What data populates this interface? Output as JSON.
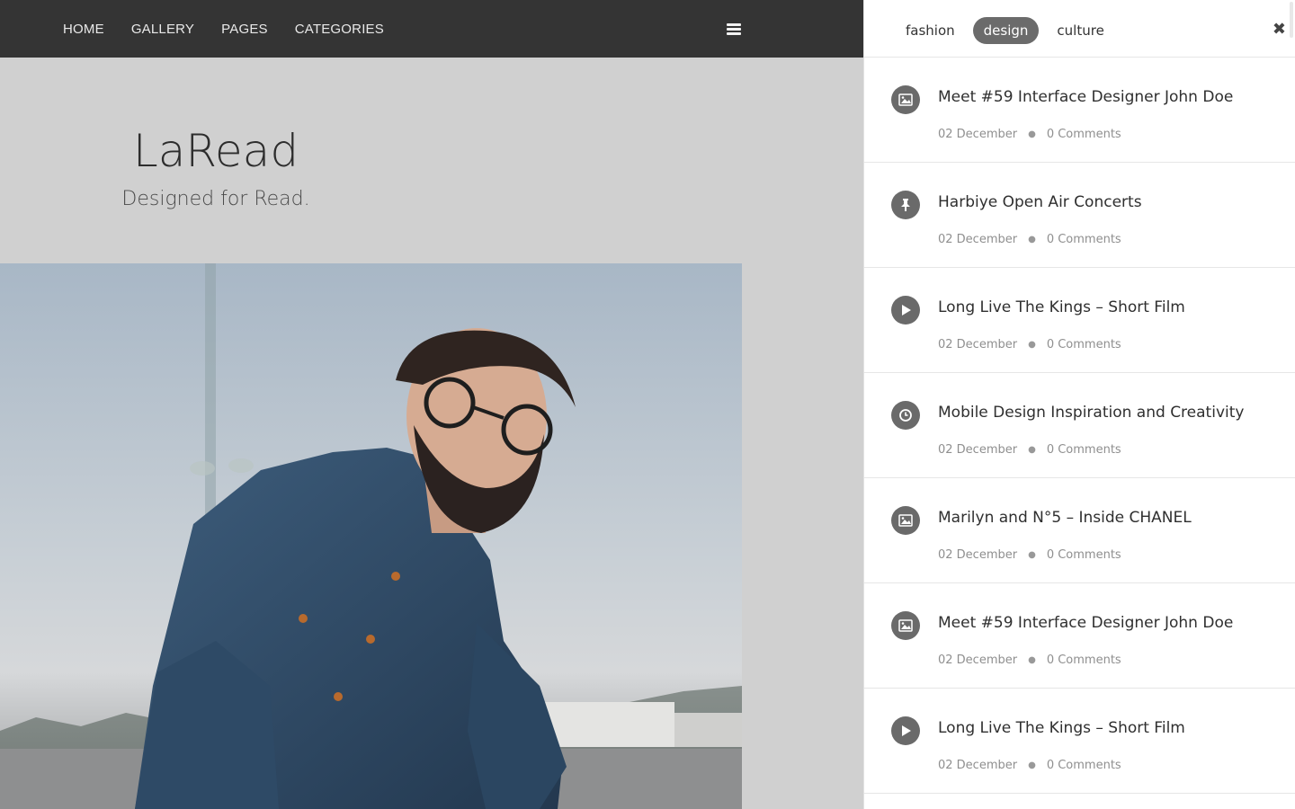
{
  "nav": {
    "items": [
      "HOME",
      "GALLERY",
      "PAGES",
      "CATEGORIES"
    ]
  },
  "hero": {
    "title": "LaRead",
    "tagline": "Designed for Read."
  },
  "drawer": {
    "tabs": [
      {
        "label": "fashion",
        "active": false
      },
      {
        "label": "design",
        "active": true
      },
      {
        "label": "culture",
        "active": false
      }
    ],
    "close_icon": "close-icon",
    "posts": [
      {
        "icon": "image-icon",
        "title": "Meet #59 Interface Designer John Doe",
        "date": "02 December",
        "comments": "0 Comments"
      },
      {
        "icon": "pin-icon",
        "title": "Harbiye Open Air Concerts",
        "date": "02 December",
        "comments": "0 Comments"
      },
      {
        "icon": "play-icon",
        "title": "Long Live The Kings – Short Film",
        "date": "02 December",
        "comments": "0 Comments"
      },
      {
        "icon": "clock-icon",
        "title": "Mobile Design Inspiration and Creativity",
        "date": "02 December",
        "comments": "0 Comments"
      },
      {
        "icon": "image-icon",
        "title": "Marilyn and N°5 – Inside CHANEL",
        "date": "02 December",
        "comments": "0 Comments"
      },
      {
        "icon": "image-icon",
        "title": "Meet #59 Interface Designer John Doe",
        "date": "02 December",
        "comments": "0 Comments"
      },
      {
        "icon": "play-icon",
        "title": "Long Live The Kings – Short Film",
        "date": "02 December",
        "comments": "0 Comments"
      }
    ]
  },
  "colors": {
    "nav_bg": "#343434",
    "hero_bg": "#d0d0d0",
    "tab_active_bg": "#6b6b6b",
    "icon_bg": "#6a6a6a"
  }
}
